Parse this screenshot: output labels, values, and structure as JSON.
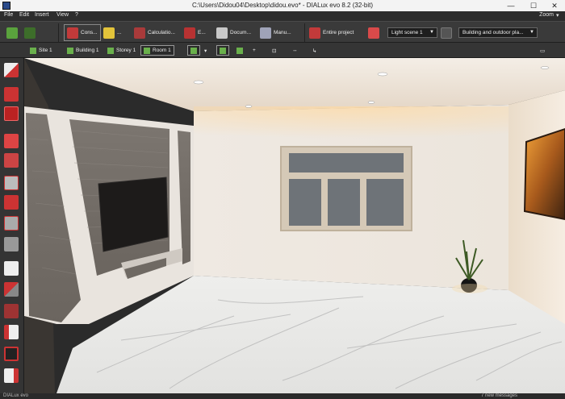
{
  "window": {
    "title": "C:\\Users\\Didou04\\Desktop\\didou.evo* - DIALux evo 8.2  (32-bit)",
    "minimize": "—",
    "maximize": "☐",
    "close": "✕"
  },
  "menu": {
    "items": [
      "File",
      "Edit",
      "Insert",
      "View",
      "?"
    ],
    "zoom": "Zoom"
  },
  "toolbar": {
    "construction": "Cons...",
    "light": "...",
    "calculation": "Calculatio...",
    "export": "E...",
    "documentation": "Docum...",
    "manufacturers": "Manu...",
    "entire_project": "Entire project",
    "light_scene": "Light scene 1",
    "planning_mode": "Building and outdoor pla..."
  },
  "breadcrumb": {
    "site": "Site 1",
    "building": "Building 1",
    "storey": "Storey 1",
    "room": "Room 1"
  },
  "statusbar": {
    "app": "DIALux evo",
    "messages": "7 new messages"
  },
  "colors": {
    "accent_green": "#6ab04c",
    "accent_red": "#d13a3a",
    "wall_light": "#e9e2d8",
    "panel_dark": "#343434"
  }
}
